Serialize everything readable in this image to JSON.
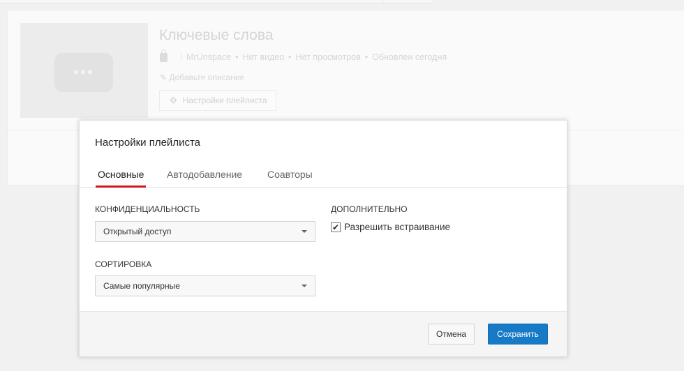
{
  "playlist": {
    "title": "Ключевые слова",
    "owner": "MrUnspace",
    "videos": "Нет видео",
    "views": "Нет просмотров",
    "updated": "Обновлен сегодня",
    "separator": "•",
    "add_description": "Добавьте описание",
    "settings_button": "Настройки плейлиста"
  },
  "modal": {
    "title": "Настройки плейлиста",
    "tabs": [
      {
        "label": "Основные",
        "active": true
      },
      {
        "label": "Автодобавление"
      },
      {
        "label": "Соавторы"
      }
    ],
    "privacy_label": "КОНФИДЕНЦИАЛЬНОСТЬ",
    "privacy_value": "Открытый доступ",
    "sort_label": "СОРТИРОВКА",
    "sort_value": "Самые популярные",
    "extra_label": "ДОПОЛНИТЕЛЬНО",
    "embed_label": "Разрешить встраивание",
    "embed_checked": true,
    "check_glyph": "✔",
    "cancel": "Отмена",
    "save": "Сохранить"
  },
  "colors": {
    "accent": "#167ac6",
    "tab_underline": "#cc181e"
  }
}
